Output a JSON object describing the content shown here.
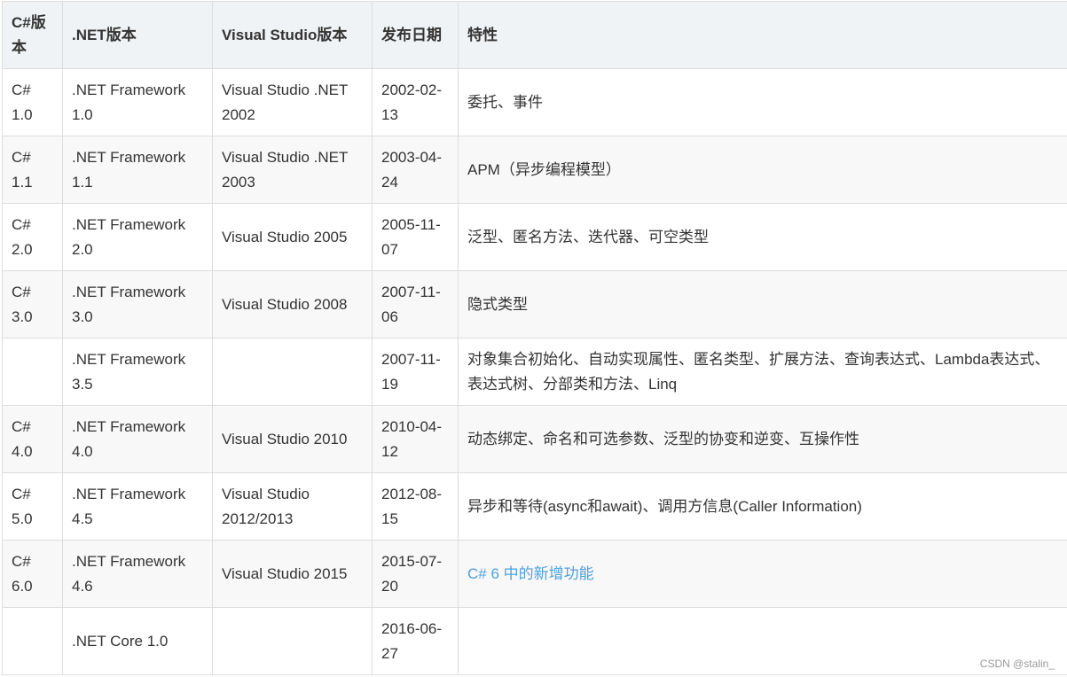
{
  "table": {
    "headers": [
      "C#版本",
      ".NET版本",
      "Visual Studio版本",
      "发布日期",
      "特性"
    ],
    "rows": [
      {
        "csharp": "C# 1.0",
        "dotnet": ".NET Framework 1.0",
        "vs": "Visual Studio .NET 2002",
        "date": "2002-02-13",
        "features": "委托、事件",
        "features_is_link": false
      },
      {
        "csharp": "C# 1.1",
        "dotnet": ".NET Framework 1.1",
        "vs": "Visual Studio .NET 2003",
        "date": "2003-04-24",
        "features": "APM（异步编程模型）",
        "features_is_link": false
      },
      {
        "csharp": "C# 2.0",
        "dotnet": ".NET Framework 2.0",
        "vs": "Visual Studio 2005",
        "date": "2005-11-07",
        "features": "泛型、匿名方法、迭代器、可空类型",
        "features_is_link": false
      },
      {
        "csharp": "C# 3.0",
        "dotnet": ".NET Framework 3.0",
        "vs": "Visual Studio 2008",
        "date": "2007-11-06",
        "features": "隐式类型",
        "features_is_link": false
      },
      {
        "csharp": "",
        "dotnet": ".NET Framework 3.5",
        "vs": "",
        "date": "2007-11-19",
        "features": "对象集合初始化、自动实现属性、匿名类型、扩展方法、查询表达式、Lambda表达式、 表达式树、分部类和方法、Linq",
        "features_is_link": false
      },
      {
        "csharp": "C# 4.0",
        "dotnet": ".NET Framework 4.0",
        "vs": "Visual Studio 2010",
        "date": "2010-04-12",
        "features": "动态绑定、命名和可选参数、泛型的协变和逆变、互操作性",
        "features_is_link": false
      },
      {
        "csharp": "C# 5.0",
        "dotnet": ".NET Framework 4.5",
        "vs": "Visual Studio 2012/2013",
        "date": "2012-08-15",
        "features": "异步和等待(async和await)、调用方信息(Caller Information)",
        "features_is_link": false
      },
      {
        "csharp": "C# 6.0",
        "dotnet": ".NET Framework 4.6",
        "vs": "Visual Studio 2015",
        "date": "2015-07-20",
        "features": "C# 6 中的新增功能",
        "features_is_link": true
      },
      {
        "csharp": "",
        "dotnet": ".NET Core 1.0",
        "vs": "",
        "date": "2016-06-27",
        "features": "",
        "features_is_link": false
      }
    ]
  },
  "watermark": "CSDN @stalin_",
  "colors": {
    "header_bg": "#eff3f5",
    "border": "#dddddd",
    "text": "#333333",
    "link": "#4ea1db",
    "row_alt_bg": "#f8f8f8"
  }
}
